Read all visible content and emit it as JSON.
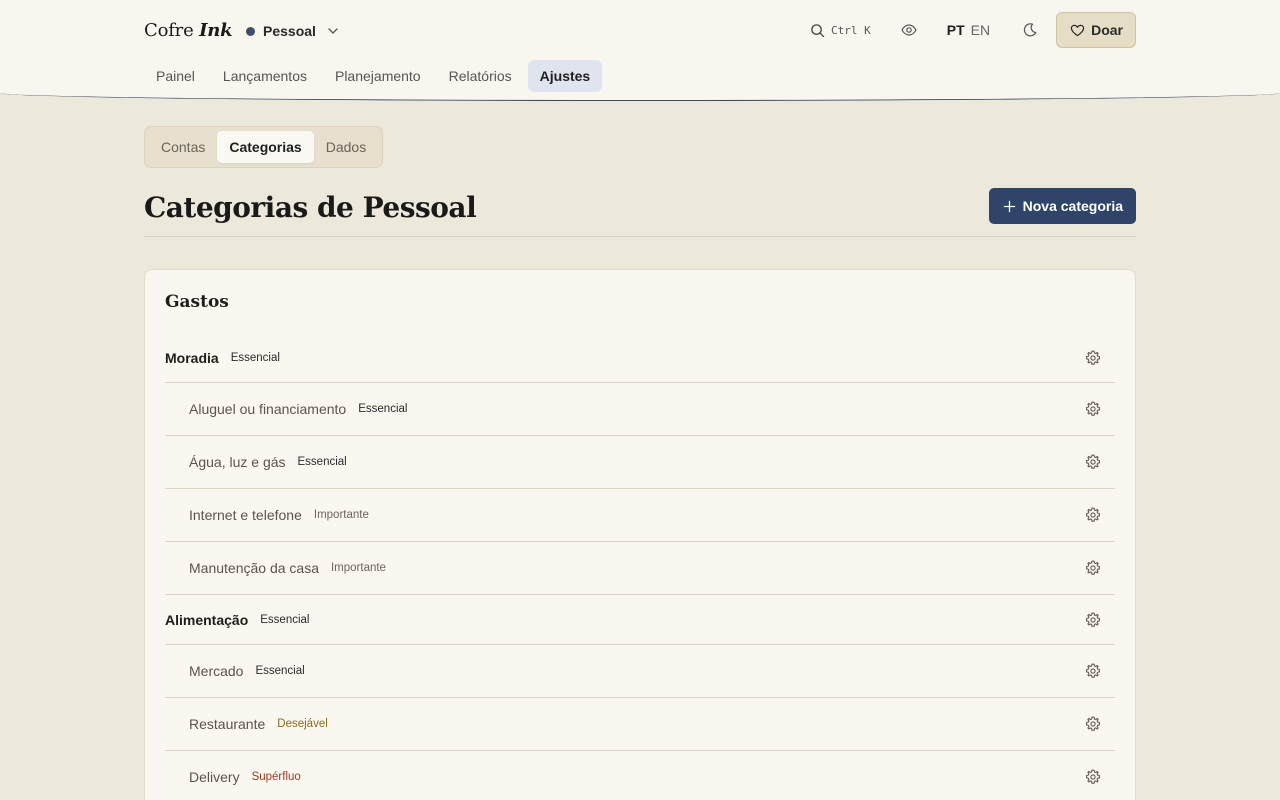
{
  "app": {
    "brand_word": "Cofre",
    "brand_accent": "Ink",
    "ledger": "Pessoal",
    "ledger_color": "#3e4f6b"
  },
  "header": {
    "search_shortcut": "Ctrl K",
    "lang_active": "PT",
    "lang_other": "EN",
    "donate_label": "Doar"
  },
  "nav": {
    "items": [
      "Painel",
      "Lançamentos",
      "Planejamento",
      "Relatórios",
      "Ajustes"
    ],
    "active": "Ajustes"
  },
  "subtabs": {
    "items": [
      "Contas",
      "Categorias",
      "Dados"
    ],
    "active": "Categorias"
  },
  "page": {
    "title": "Categorias de Pessoal",
    "new_button": "Nova categoria",
    "accent": "#2f4468"
  },
  "section": {
    "title": "Gastos",
    "rows": [
      {
        "name": "Moradia",
        "badge": "Essencial",
        "level": "parent"
      },
      {
        "name": "Aluguel ou financiamento",
        "badge": "Essencial",
        "level": "child"
      },
      {
        "name": "Água, luz e gás",
        "badge": "Essencial",
        "level": "child"
      },
      {
        "name": "Internet e telefone",
        "badge": "Importante",
        "level": "child"
      },
      {
        "name": "Manutenção da casa",
        "badge": "Importante",
        "level": "child"
      },
      {
        "name": "Alimentação",
        "badge": "Essencial",
        "level": "parent"
      },
      {
        "name": "Mercado",
        "badge": "Essencial",
        "level": "child"
      },
      {
        "name": "Restaurante",
        "badge": "Desejável",
        "level": "child"
      },
      {
        "name": "Delivery",
        "badge": "Supérfluo",
        "level": "child"
      }
    ]
  },
  "badge_colors": {
    "Essencial": "#2a2a2a",
    "Importante": "#6b665c",
    "Desejável": "#8a6a1a",
    "Supérfluo": "#9a3b22"
  }
}
